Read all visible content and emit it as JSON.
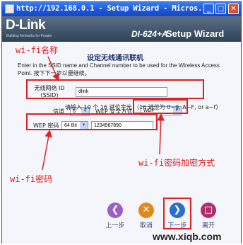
{
  "window": {
    "title": "http://192.168.0.1 - Setup Wizard - Micros...",
    "min": "_",
    "max": "□",
    "close": "✕"
  },
  "header": {
    "logo": "D-Link",
    "logo_sub": "Building Networks for People",
    "model": "DI-624+A",
    "setup": "Setup Wizard"
  },
  "page": {
    "title": "设定无线通讯联机",
    "description": "Enter in the SSID name and Channel number to be used for the Wireless Access Point. 按下下一步以便继续。"
  },
  "form": {
    "ssid_label": "无线网络 ID (SSID)",
    "ssid_value": "dlink",
    "channel_label": "信道",
    "channel_value": "6",
    "wep_mode_label": "WEP 安全方式",
    "wep_mode_value": "WEP",
    "wep_key_label": "WEP 密码",
    "wep_bits_value": "64 Bit",
    "wep_key_value": "1234567890",
    "hint": "请输入 10 个 16 进位字元 （16 进位为 0~9, A~F, or a~f）"
  },
  "annotations": {
    "ssid": "wi-fi名称",
    "password": "wi-fi密码",
    "encryption": "wi-fi密码加密方式"
  },
  "buttons": {
    "back": "上一步",
    "cancel": "取消",
    "next": "下一步",
    "exit": "离开"
  },
  "watermark": "www.xiqb.com"
}
